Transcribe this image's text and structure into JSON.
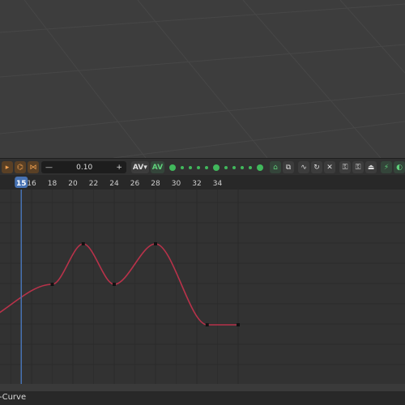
{
  "toolbar": {
    "minus_label": "—",
    "value": "0.10",
    "plus_label": "+",
    "av_dropdown_label": "AV",
    "av_label": "AV"
  },
  "timeline": {
    "current_frame": "15",
    "frame_labels": [
      "16",
      "18",
      "20",
      "22",
      "24",
      "26",
      "28",
      "30",
      "32",
      "34"
    ]
  },
  "curve": {
    "color": "#b8324a",
    "keyframes": [
      {
        "frame": 10,
        "value": 0.0
      },
      {
        "frame": 18,
        "value": 0.5
      },
      {
        "frame": 21,
        "value": 1.0
      },
      {
        "frame": 24,
        "value": 0.5
      },
      {
        "frame": 28,
        "value": 1.0
      },
      {
        "frame": 33,
        "value": 0.0
      },
      {
        "frame": 36,
        "value": 0.0
      }
    ]
  },
  "status": {
    "editor_label": "-Curve"
  },
  "colors": {
    "accent": "#4772b3",
    "keyframe_green": "#41b85c",
    "orange": "#f0a050"
  }
}
